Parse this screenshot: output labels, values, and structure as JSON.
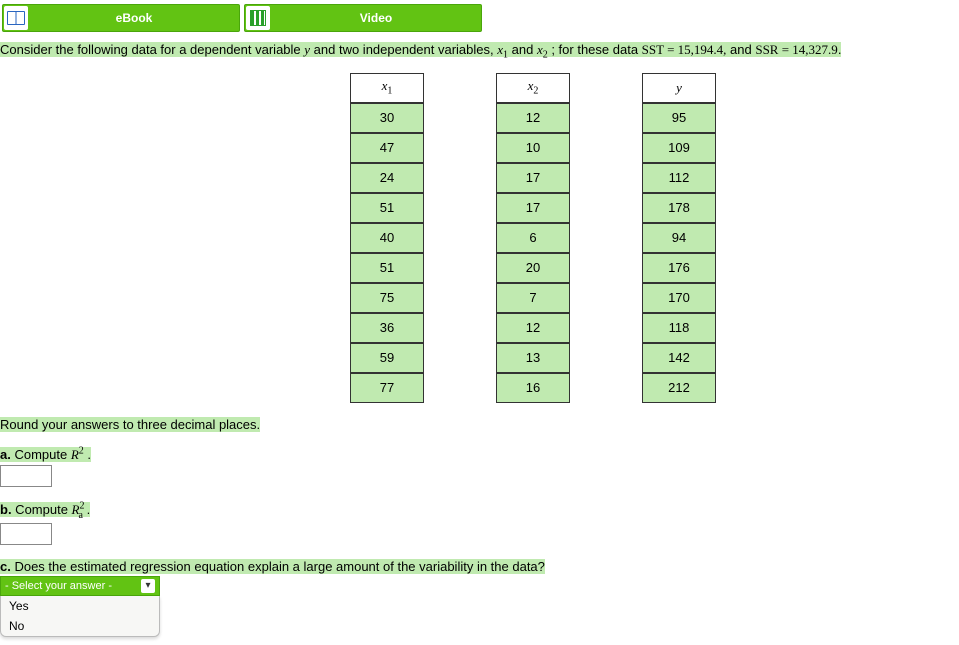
{
  "topbar": {
    "ebook_label": "eBook",
    "video_label": "Video"
  },
  "question": {
    "pre": "Consider the following data for a dependent variable ",
    "y": "y",
    "mid1": " and two independent variables, ",
    "x1": "x",
    "x1_sub": "1",
    "mid2": " and ",
    "x2": "x",
    "x2_sub": "2",
    "mid3": " ; for these data ",
    "sst": "SST = 15,194.4,",
    "mid4": " and ",
    "ssr": "SSR = 14,327.9",
    "period": "."
  },
  "table": {
    "headers": {
      "x1": "x",
      "x1_sub": "1",
      "x2": "x",
      "x2_sub": "2",
      "y": "y"
    },
    "rows": [
      {
        "x1": "30",
        "x2": "12",
        "y": "95"
      },
      {
        "x1": "47",
        "x2": "10",
        "y": "109"
      },
      {
        "x1": "24",
        "x2": "17",
        "y": "112"
      },
      {
        "x1": "51",
        "x2": "17",
        "y": "178"
      },
      {
        "x1": "40",
        "x2": "6",
        "y": "94"
      },
      {
        "x1": "51",
        "x2": "20",
        "y": "176"
      },
      {
        "x1": "75",
        "x2": "7",
        "y": "170"
      },
      {
        "x1": "36",
        "x2": "12",
        "y": "118"
      },
      {
        "x1": "59",
        "x2": "13",
        "y": "142"
      },
      {
        "x1": "77",
        "x2": "16",
        "y": "212"
      }
    ]
  },
  "instructions": {
    "round": "Round your answers to three decimal places.",
    "a_pre": "a.",
    "a_text": " Compute ",
    "a_sym_base": "R",
    "a_sym_sup": "2",
    "a_period": " .",
    "b_pre": "b.",
    "b_text": " Compute ",
    "b_sym_base": "R",
    "b_sym_sup": "2",
    "b_sym_sub": "a",
    "b_period": " .",
    "c_pre": "c.",
    "c_text": " Does the estimated regression equation explain a large amount of the variability in the data?"
  },
  "select": {
    "placeholder": "- Select your answer -",
    "options": [
      "Yes",
      "No"
    ]
  }
}
